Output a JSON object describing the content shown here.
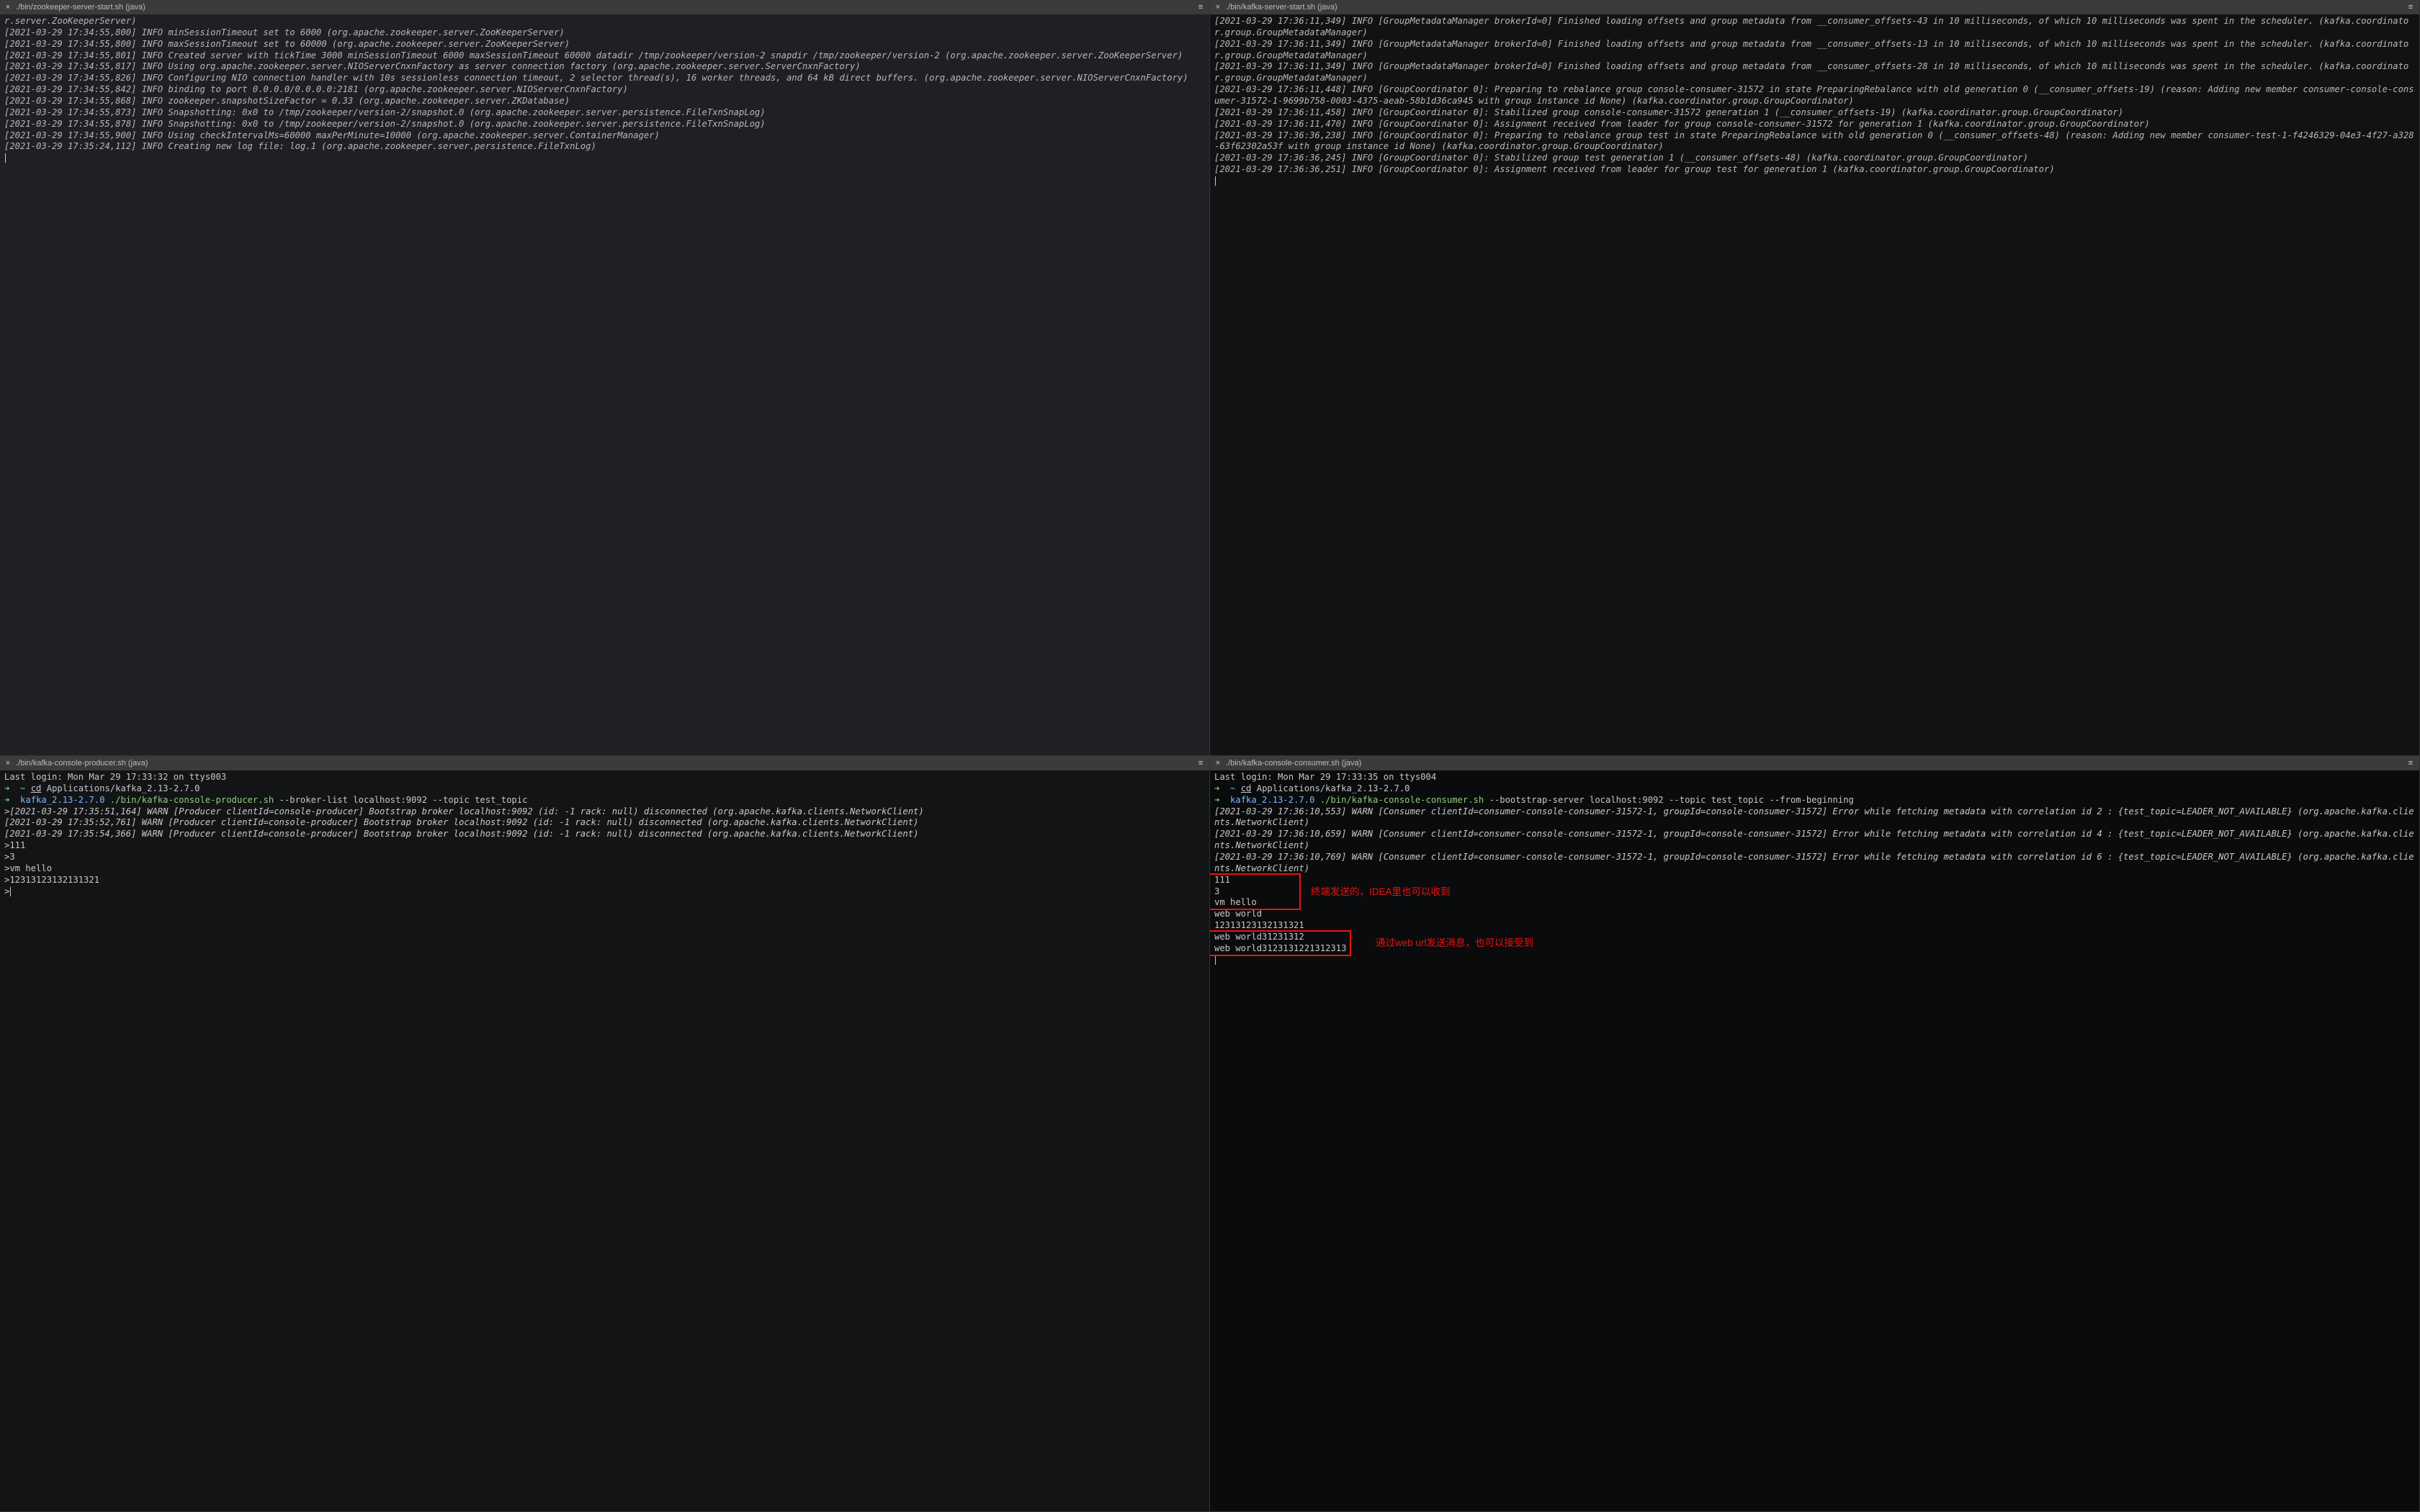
{
  "panes": {
    "tl": {
      "tab_title": "./bin/zookeeper-server-start.sh (java)",
      "lines": [
        "r.server.ZooKeeperServer)",
        "[2021-03-29 17:34:55,800] INFO minSessionTimeout set to 6000 (org.apache.zookeeper.server.ZooKeeperServer)",
        "[2021-03-29 17:34:55,800] INFO maxSessionTimeout set to 60000 (org.apache.zookeeper.server.ZooKeeperServer)",
        "[2021-03-29 17:34:55,801] INFO Created server with tickTime 3000 minSessionTimeout 6000 maxSessionTimeout 60000 datadir /tmp/zookeeper/version-2 snapdir /tmp/zookeeper/version-2 (org.apache.zookeeper.server.ZooKeeperServer)",
        "[2021-03-29 17:34:55,817] INFO Using org.apache.zookeeper.server.NIOServerCnxnFactory as server connection factory (org.apache.zookeeper.server.ServerCnxnFactory)",
        "[2021-03-29 17:34:55,826] INFO Configuring NIO connection handler with 10s sessionless connection timeout, 2 selector thread(s), 16 worker threads, and 64 kB direct buffers. (org.apache.zookeeper.server.NIOServerCnxnFactory)",
        "[2021-03-29 17:34:55,842] INFO binding to port 0.0.0.0/0.0.0.0:2181 (org.apache.zookeeper.server.NIOServerCnxnFactory)",
        "[2021-03-29 17:34:55,868] INFO zookeeper.snapshotSizeFactor = 0.33 (org.apache.zookeeper.server.ZKDatabase)",
        "[2021-03-29 17:34:55,873] INFO Snapshotting: 0x0 to /tmp/zookeeper/version-2/snapshot.0 (org.apache.zookeeper.server.persistence.FileTxnSnapLog)",
        "[2021-03-29 17:34:55,878] INFO Snapshotting: 0x0 to /tmp/zookeeper/version-2/snapshot.0 (org.apache.zookeeper.server.persistence.FileTxnSnapLog)",
        "[2021-03-29 17:34:55,900] INFO Using checkIntervalMs=60000 maxPerMinute=10000 (org.apache.zookeeper.server.ContainerManager)",
        "[2021-03-29 17:35:24,112] INFO Creating new log file: log.1 (org.apache.zookeeper.server.persistence.FileTxnLog)"
      ]
    },
    "tr": {
      "tab_title": "./bin/kafka-server-start.sh (java)",
      "lines": [
        "[2021-03-29 17:36:11,349] INFO [GroupMetadataManager brokerId=0] Finished loading offsets and group metadata from __consumer_offsets-43 in 10 milliseconds, of which 10 milliseconds was spent in the scheduler. (kafka.coordinator.group.GroupMetadataManager)",
        "[2021-03-29 17:36:11,349] INFO [GroupMetadataManager brokerId=0] Finished loading offsets and group metadata from __consumer_offsets-13 in 10 milliseconds, of which 10 milliseconds was spent in the scheduler. (kafka.coordinator.group.GroupMetadataManager)",
        "[2021-03-29 17:36:11,349] INFO [GroupMetadataManager brokerId=0] Finished loading offsets and group metadata from __consumer_offsets-28 in 10 milliseconds, of which 10 milliseconds was spent in the scheduler. (kafka.coordinator.group.GroupMetadataManager)",
        "[2021-03-29 17:36:11,448] INFO [GroupCoordinator 0]: Preparing to rebalance group console-consumer-31572 in state PreparingRebalance with old generation 0 (__consumer_offsets-19) (reason: Adding new member consumer-console-consumer-31572-1-9699b758-0003-4375-aeab-58b1d36ca945 with group instance id None) (kafka.coordinator.group.GroupCoordinator)",
        "[2021-03-29 17:36:11,458] INFO [GroupCoordinator 0]: Stabilized group console-consumer-31572 generation 1 (__consumer_offsets-19) (kafka.coordinator.group.GroupCoordinator)",
        "[2021-03-29 17:36:11,470] INFO [GroupCoordinator 0]: Assignment received from leader for group console-consumer-31572 for generation 1 (kafka.coordinator.group.GroupCoordinator)",
        "[2021-03-29 17:36:36,238] INFO [GroupCoordinator 0]: Preparing to rebalance group test in state PreparingRebalance with old generation 0 (__consumer_offsets-48) (reason: Adding new member consumer-test-1-f4246329-04e3-4f27-a328-63f62302a53f with group instance id None) (kafka.coordinator.group.GroupCoordinator)",
        "[2021-03-29 17:36:36,245] INFO [GroupCoordinator 0]: Stabilized group test generation 1 (__consumer_offsets-48) (kafka.coordinator.group.GroupCoordinator)",
        "[2021-03-29 17:36:36,251] INFO [GroupCoordinator 0]: Assignment received from leader for group test for generation 1 (kafka.coordinator.group.GroupCoordinator)"
      ]
    },
    "bl": {
      "tab_title": "./bin/kafka-console-producer.sh (java)",
      "last_login": "Last login: Mon Mar 29 17:33:32 on ttys003",
      "cd_cmd": "cd",
      "cd_arg": "Applications/kafka_2.13-2.7.0",
      "cwd": "kafka_2.13-2.7.0",
      "exec": "./bin/kafka-console-producer.sh",
      "exec_args": "--broker-list localhost:9092 --topic test_topic",
      "warn_lines": [
        ">[2021-03-29 17:35:51,164] WARN [Producer clientId=console-producer] Bootstrap broker localhost:9092 (id: -1 rack: null) disconnected (org.apache.kafka.clients.NetworkClient)",
        "[2021-03-29 17:35:52,761] WARN [Producer clientId=console-producer] Bootstrap broker localhost:9092 (id: -1 rack: null) disconnected (org.apache.kafka.clients.NetworkClient)",
        "[2021-03-29 17:35:54,366] WARN [Producer clientId=console-producer] Bootstrap broker localhost:9092 (id: -1 rack: null) disconnected (org.apache.kafka.clients.NetworkClient)"
      ],
      "inputs": [
        ">111",
        ">3",
        ">vm hello",
        ">12313123132131321",
        ">"
      ]
    },
    "br": {
      "tab_title": "./bin/kafka-console-consumer.sh (java)",
      "last_login": "Last login: Mon Mar 29 17:33:35 on ttys004",
      "cd_cmd": "cd",
      "cd_arg": "Applications/kafka_2.13-2.7.0",
      "cwd": "kafka_2.13-2.7.0",
      "exec": "./bin/kafka-console-consumer.sh",
      "exec_args": "--bootstrap-server localhost:9092 --topic test_topic --from-beginning",
      "warn_lines": [
        "[2021-03-29 17:36:10,553] WARN [Consumer clientId=consumer-console-consumer-31572-1, groupId=console-consumer-31572] Error while fetching metadata with correlation id 2 : {test_topic=LEADER_NOT_AVAILABLE} (org.apache.kafka.clients.NetworkClient)",
        "[2021-03-29 17:36:10,659] WARN [Consumer clientId=consumer-console-consumer-31572-1, groupId=console-consumer-31572] Error while fetching metadata with correlation id 4 : {test_topic=LEADER_NOT_AVAILABLE} (org.apache.kafka.clients.NetworkClient)",
        "[2021-03-29 17:36:10,769] WARN [Consumer clientId=consumer-console-consumer-31572-1, groupId=console-consumer-31572] Error while fetching metadata with correlation id 6 : {test_topic=LEADER_NOT_AVAILABLE} (org.apache.kafka.clients.NetworkClient)"
      ],
      "group1": [
        "111",
        "3",
        "vm hello"
      ],
      "middle": [
        "web world",
        "12313123132131321"
      ],
      "group2": [
        "web world31231312",
        "web world3123131221312313"
      ],
      "annot1": "终端发送的，IDEA里也可以收到",
      "annot2": "通过web url发送消息，也可以接受到"
    }
  }
}
